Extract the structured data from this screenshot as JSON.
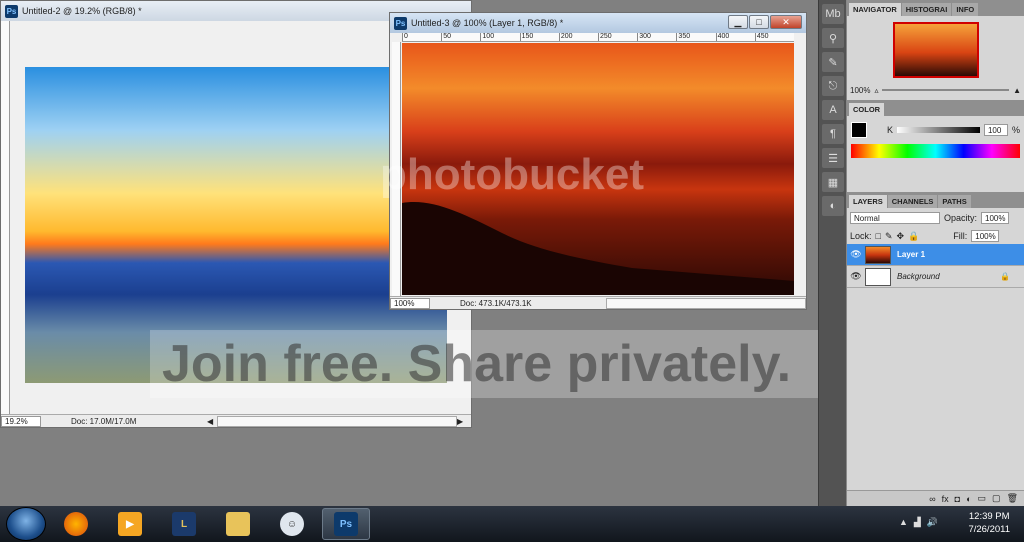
{
  "window1": {
    "title": "Untitled-2 @ 19.2% (RGB/8) *",
    "zoom": "19.2%",
    "doc_info": "Doc: 17.0M/17.0M"
  },
  "window2": {
    "title": "Untitled-3 @ 100% (Layer 1, RGB/8) *",
    "zoom": "100%",
    "doc_info": "Doc: 473.1K/473.1K",
    "ruler_ticks": [
      "0",
      "50",
      "100",
      "150",
      "200",
      "250",
      "300",
      "350",
      "400",
      "450"
    ]
  },
  "navigator": {
    "tabs": [
      "NAVIGATOR",
      "HISTOGRAI",
      "INFO"
    ],
    "zoom": "100%"
  },
  "color_panel": {
    "tab": "COLOR",
    "channel": "K",
    "value": "100",
    "unit": "%"
  },
  "layers_panel": {
    "tabs": [
      "LAYERS",
      "CHANNELS",
      "PATHS"
    ],
    "blend_mode": "Normal",
    "opacity_label": "Opacity:",
    "opacity": "100%",
    "lock_label": "Lock:",
    "fill_label": "Fill:",
    "fill": "100%",
    "layers": [
      {
        "name": "Layer 1",
        "selected": true
      },
      {
        "name": "Background",
        "selected": false
      }
    ]
  },
  "taskbar": {
    "time": "12:39 PM",
    "date": "7/26/2011"
  },
  "watermark": {
    "logo": "photobucket",
    "tagline": "Join free. Share privately."
  }
}
